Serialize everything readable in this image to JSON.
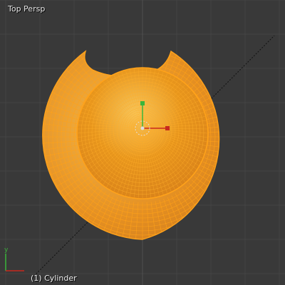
{
  "viewport": {
    "view_label": "Top Persp",
    "object_label": "(1) Cylinder"
  },
  "axes_gizmo": {
    "y_label": "y",
    "x_label": "x"
  },
  "colors": {
    "background": "#393939",
    "grid_line": "#444444",
    "grid_major": "#4a4a4a",
    "mesh_selected": "#e8961c",
    "mesh_edge": "#ffa21a",
    "mesh_highlight": "#f6c75e",
    "axis_x": "#c8291e",
    "axis_y": "#3bb53b",
    "origin_center": "#dddddd"
  },
  "icons": {
    "origin": "origin-dot-icon",
    "manipulator": "manipulator-icon"
  }
}
